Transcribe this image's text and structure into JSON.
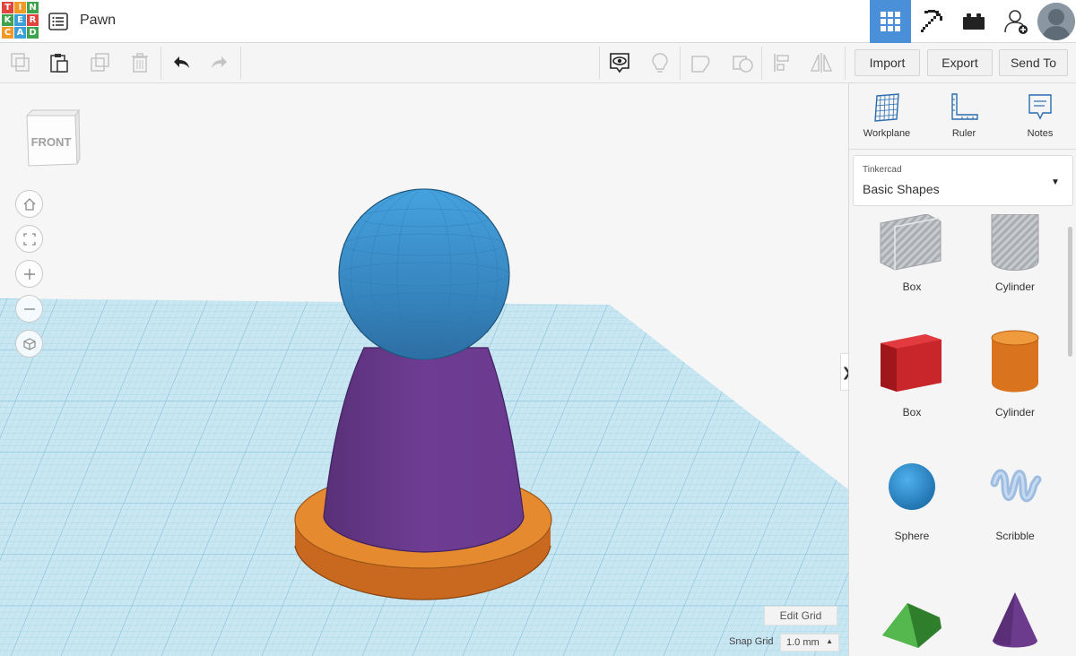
{
  "app": {
    "logo_letters": [
      "T",
      "I",
      "N",
      "K",
      "E",
      "R",
      "C",
      "A",
      "D"
    ],
    "logo_colors": [
      "#e2433b",
      "#f29824",
      "#3fa34d",
      "#3fa34d",
      "#3d9fd9",
      "#e2433b",
      "#f29824",
      "#3d9fd9",
      "#3fa34d"
    ],
    "design_title": "Pawn"
  },
  "toolbar": {
    "import_label": "Import",
    "export_label": "Export",
    "sendto_label": "Send To",
    "icons": [
      "copy-icon",
      "paste-icon",
      "duplicate-icon",
      "delete-icon",
      "undo-icon",
      "redo-icon",
      "notes-visibility-icon",
      "lightbulb-icon",
      "group-icon",
      "ungroup-icon",
      "align-icon",
      "mirror-icon"
    ]
  },
  "top_right": {
    "icons": [
      "3d-design-grid-icon",
      "codeblocks-pickaxe-icon",
      "bricks-icon",
      "add-user-icon",
      "avatar"
    ]
  },
  "viewport": {
    "viewcube_label": "FRONT",
    "nav_icons": [
      "home-icon",
      "fit-view-icon",
      "zoom-in-icon",
      "zoom-out-icon",
      "perspective-icon"
    ],
    "edit_grid_label": "Edit Grid",
    "snap_grid_label": "Snap Grid",
    "snap_grid_value": "1.0 mm",
    "collapse_glyph": "❯",
    "workplane_color": "#bfe1ee",
    "sphere_color": "#3b8fc7",
    "cone_color": "#6c3b8e",
    "base_color": "#e58a2f"
  },
  "panel": {
    "tools": [
      {
        "label": "Workplane",
        "icon": "workplane-icon"
      },
      {
        "label": "Ruler",
        "icon": "ruler-icon"
      },
      {
        "label": "Notes",
        "icon": "notes-icon"
      }
    ],
    "library_provider": "Tinkercad",
    "library_name": "Basic Shapes",
    "shapes": [
      {
        "label": "Box",
        "icon": "box-hole-icon",
        "color": "#bfc3c7"
      },
      {
        "label": "Cylinder",
        "icon": "cylinder-hole-icon",
        "color": "#bfc3c7"
      },
      {
        "label": "Box",
        "icon": "box-icon",
        "color": "#d0262b"
      },
      {
        "label": "Cylinder",
        "icon": "cylinder-icon",
        "color": "#e57e22"
      },
      {
        "label": "Sphere",
        "icon": "sphere-icon",
        "color": "#2d8bcf"
      },
      {
        "label": "Scribble",
        "icon": "scribble-icon",
        "color": "#a9c3e0"
      },
      {
        "label": "",
        "icon": "roof-icon",
        "color": "#3f9f3a"
      },
      {
        "label": "",
        "icon": "cone-icon",
        "color": "#6c3b8e"
      }
    ]
  }
}
